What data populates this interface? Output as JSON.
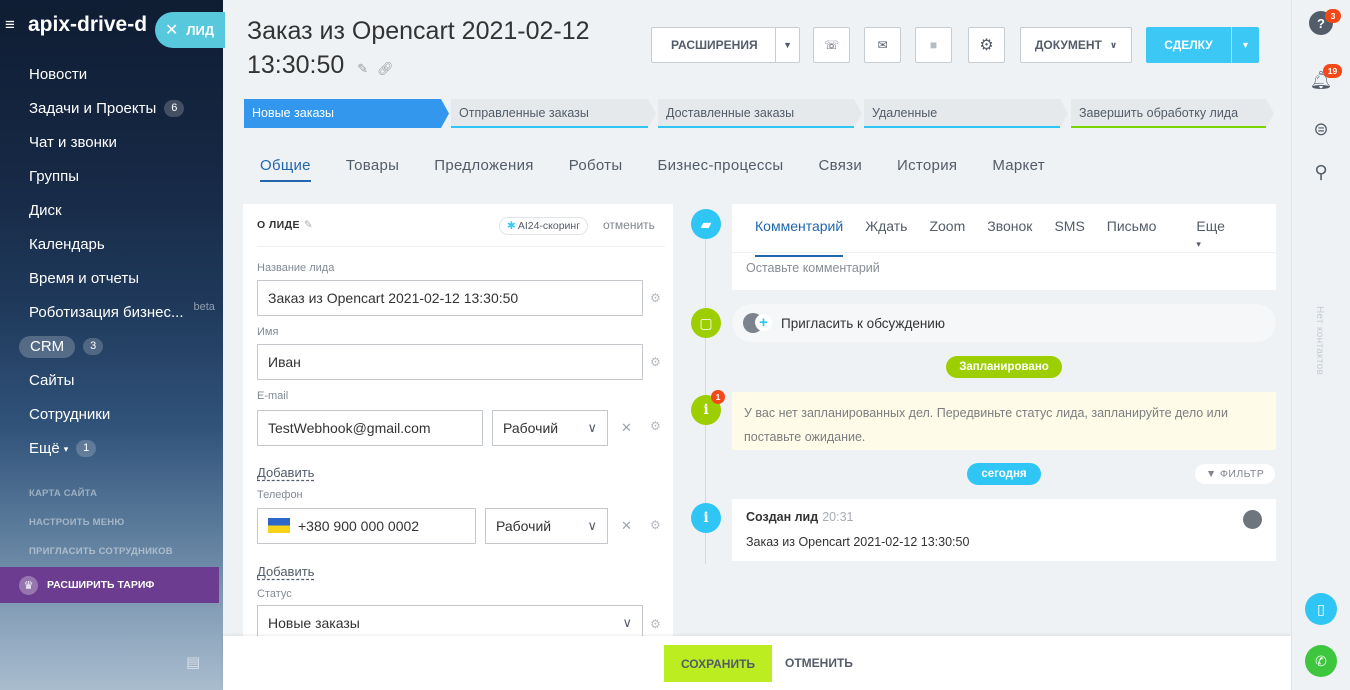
{
  "sidebar": {
    "portal_name": "apix-drive-d",
    "items": [
      {
        "label": "Новости",
        "count": ""
      },
      {
        "label": "Задачи и Проекты",
        "count": "6"
      },
      {
        "label": "Чат и звонки",
        "count": ""
      },
      {
        "label": "Группы",
        "count": ""
      },
      {
        "label": "Диск",
        "count": ""
      },
      {
        "label": "Календарь",
        "count": ""
      },
      {
        "label": "Время и отчеты",
        "count": ""
      },
      {
        "label": "Роботизация бизнес...",
        "badge": "beta"
      },
      {
        "label": "CRM",
        "count": "3"
      },
      {
        "label": "Сайты",
        "count": ""
      },
      {
        "label": "Сотрудники",
        "count": ""
      },
      {
        "label": "Ещё",
        "count": "1"
      }
    ],
    "sub_links": [
      "КАРТА САЙТА",
      "НАСТРОИТЬ МЕНЮ",
      "ПРИГЛАСИТЬ СОТРУДНИКОВ"
    ],
    "upgrade_label": "РАСШИРИТЬ ТАРИФ"
  },
  "lead_tag": "ЛИД",
  "header": {
    "title": "Заказ из Opencart 2021-02-12 13:30:50",
    "extensions_label": "РАСШИРЕНИЯ",
    "document_label": "ДОКУМЕНТ",
    "deal_label": "СДЕЛКУ"
  },
  "stages": [
    {
      "label": "Новые заказы",
      "color": "#3398ed",
      "active": true
    },
    {
      "label": "Отправленные заказы",
      "color": "#2fc6f6"
    },
    {
      "label": "Доставленные заказы",
      "color": "#2fc6f6"
    },
    {
      "label": "Удаленные",
      "color": "#2fc6f6"
    },
    {
      "label": "Завершить обработку лида",
      "color": "#7bd500"
    }
  ],
  "tabs": [
    "Общие",
    "Товары",
    "Предложения",
    "Роботы",
    "Бизнес-процессы",
    "Связи",
    "История",
    "Маркет"
  ],
  "about": {
    "header": "О ЛИДЕ",
    "ai_scoring": "AI24-скоринг",
    "cancel": "отменить",
    "lead_name_label": "Название лида",
    "lead_name_value": "Заказ из Opencart 2021-02-12 13:30:50",
    "name_label": "Имя",
    "name_value": "Иван",
    "email_label": "E-mail",
    "email_value": "TestWebhook@gmail.com",
    "email_type": "Рабочий",
    "add_label": "Добавить",
    "phone_label": "Телефон",
    "phone_value": "+380 900 000 0002",
    "phone_type": "Рабочий",
    "add_label2": "Добавить",
    "status_label": "Статус",
    "status_value": "Новые заказы"
  },
  "timeline": {
    "tabs": [
      "Комментарий",
      "Ждать",
      "Zoom",
      "Звонок",
      "SMS",
      "Письмо"
    ],
    "more": "Еще",
    "comment_placeholder": "Оставьте комментарий",
    "invite": "Пригласить к обсуждению",
    "planned_pill": "Запланировано",
    "planned_badge": "1",
    "planned_text": "У вас нет запланированных дел. Передвиньте статус лида, запланируйте дело или поставьте ожидание.",
    "today_pill": "сегодня",
    "filter": "ФИЛЬТР",
    "created_title": "Создан лид",
    "created_time": "20:31",
    "created_text": "Заказ из Opencart 2021-02-12 13:30:50"
  },
  "footer": {
    "save": "СОХРАНИТЬ",
    "cancel": "ОТМЕНИТЬ"
  },
  "rightbar": {
    "help_badge": "3",
    "notif_badge": "19",
    "vertical_text": "Нет контактов"
  },
  "colors": {
    "accent": "#3398ed",
    "deal": "#3bc8f5",
    "save": "#bbed21",
    "timeline_green": "#9dcf00",
    "timeline_blue": "#2fc6f6"
  }
}
